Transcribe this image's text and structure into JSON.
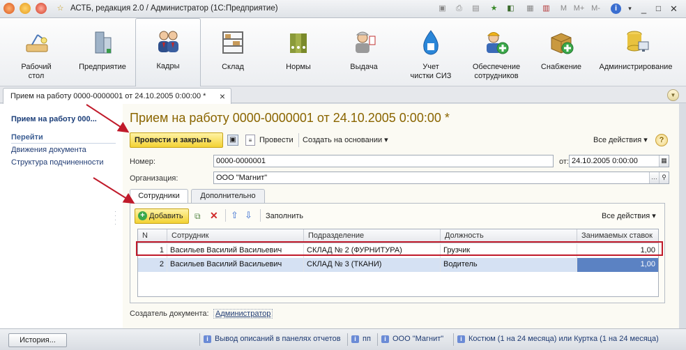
{
  "window": {
    "title": "АСТБ, редакция 2.0 / Администратор  (1С:Предприятие)",
    "toolbar_glyphs": {
      "m": "M",
      "m_plus": "M+",
      "m_minus": "M-",
      "info": "i"
    }
  },
  "sections": [
    {
      "label": "Рабочий\nстол",
      "icon": "desk-lamp-icon"
    },
    {
      "label": "Предприятие",
      "icon": "building-icon"
    },
    {
      "label": "Кадры",
      "icon": "people-icon",
      "active": true
    },
    {
      "label": "Склад",
      "icon": "shelves-icon"
    },
    {
      "label": "Нормы",
      "icon": "binders-icon"
    },
    {
      "label": "Выдача",
      "icon": "worker-icon"
    },
    {
      "label": "Учет\nчистки СИЗ",
      "icon": "water-drop-icon"
    },
    {
      "label": "Обеспечение\nсотрудников",
      "icon": "worker-plus-icon"
    },
    {
      "label": "Снабжение",
      "icon": "box-plus-icon"
    },
    {
      "label": "Администрирование",
      "icon": "database-icon"
    }
  ],
  "open_tab": {
    "label": "Прием на работу 0000-0000001 от 24.10.2005 0:00:00 *",
    "close": "×"
  },
  "nav": {
    "current": "Прием на работу 000...",
    "group": "Перейти",
    "links": [
      "Движения документа",
      "Структура подчиненности"
    ]
  },
  "form": {
    "title": "Прием на работу 0000-0000001 от 24.10.2005 0:00:00 *",
    "toolbar": {
      "post_close": "Провести и закрыть",
      "post": "Провести",
      "based_on": "Создать на основании ▾",
      "all_actions": "Все действия ▾",
      "help": "?"
    },
    "number_label": "Номер:",
    "number_value": "0000-0000001",
    "date_label": "от:",
    "date_value": "24.10.2005  0:00:00",
    "org_label": "Организация:",
    "org_value": "ООО \"Магнит\"",
    "tabs": [
      "Сотрудники",
      "Дополнительно"
    ],
    "table_toolbar": {
      "add": "Добавить",
      "fill": "Заполнить",
      "all_actions": "Все действия ▾"
    },
    "columns": [
      "N",
      "Сотрудник",
      "Подразделение",
      "Должность",
      "Занимаемых ставок"
    ],
    "rows": [
      {
        "n": "1",
        "employee": "Васильев Василий Васильевич",
        "dept": "СКЛАД № 2 (ФУРНИТУРА)",
        "position": "Грузчик",
        "rate": "1,00"
      },
      {
        "n": "2",
        "employee": "Васильев Василий Васильевич",
        "dept": "СКЛАД № 3 (ТКАНИ)",
        "position": "Водитель",
        "rate": "1,00"
      }
    ],
    "author_label": "Создатель документа:",
    "author_value": "Администратор"
  },
  "statusbar": {
    "history": "История...",
    "items": [
      {
        "icon": "i",
        "text": "Вывод описаний в панелях отчетов"
      },
      {
        "icon": "i",
        "text": "пп"
      },
      {
        "icon": "i",
        "text": "ООО \"Магнит\""
      },
      {
        "icon": "i",
        "text": "Костюм (1 на 24 месяца) или Куртка (1 на 24 месяца)"
      }
    ]
  },
  "colors": {
    "accent": "#f3d233",
    "title": "#8a6500",
    "selection": "#5b82c3",
    "annotation": "#c01a2a"
  }
}
